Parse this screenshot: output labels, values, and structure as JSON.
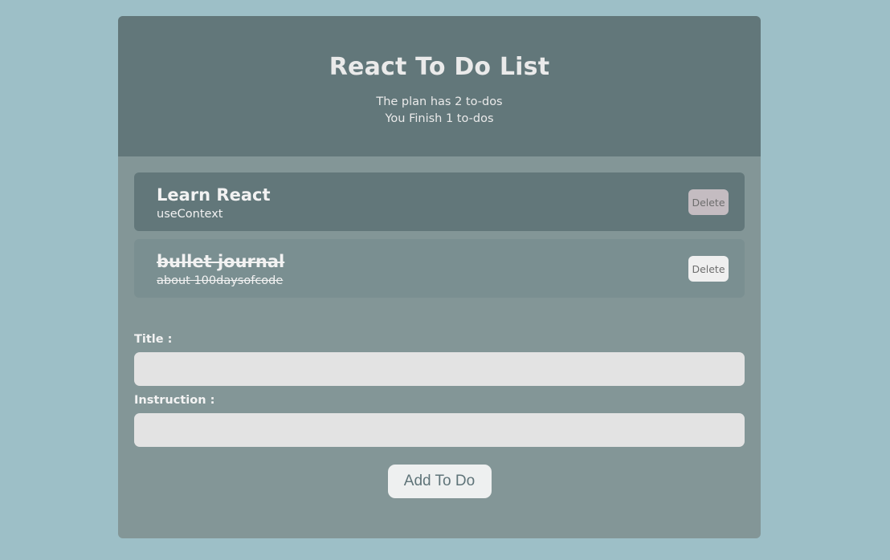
{
  "header": {
    "title": "React To Do List",
    "plan_text": "The plan has 2 to-dos",
    "finish_text": "You Finish 1 to-dos"
  },
  "todos": [
    {
      "title": "Learn React",
      "description": "useContext",
      "completed": false,
      "delete_label": "Delete"
    },
    {
      "title": "bullet journal",
      "description": "about 100daysofcode",
      "completed": true,
      "delete_label": "Delete"
    }
  ],
  "form": {
    "title_label": "Title :",
    "title_value": "",
    "instruction_label": "Instruction :",
    "instruction_value": "",
    "submit_label": "Add To Do"
  },
  "colors": {
    "page_background": "#9dbfc7",
    "app_background": "#839697",
    "header_background": "#62777a",
    "active_todo_background": "#62777a",
    "completed_todo_background": "#7a8f91",
    "input_background": "#e3e3e3",
    "button_background": "#eef0f0"
  }
}
